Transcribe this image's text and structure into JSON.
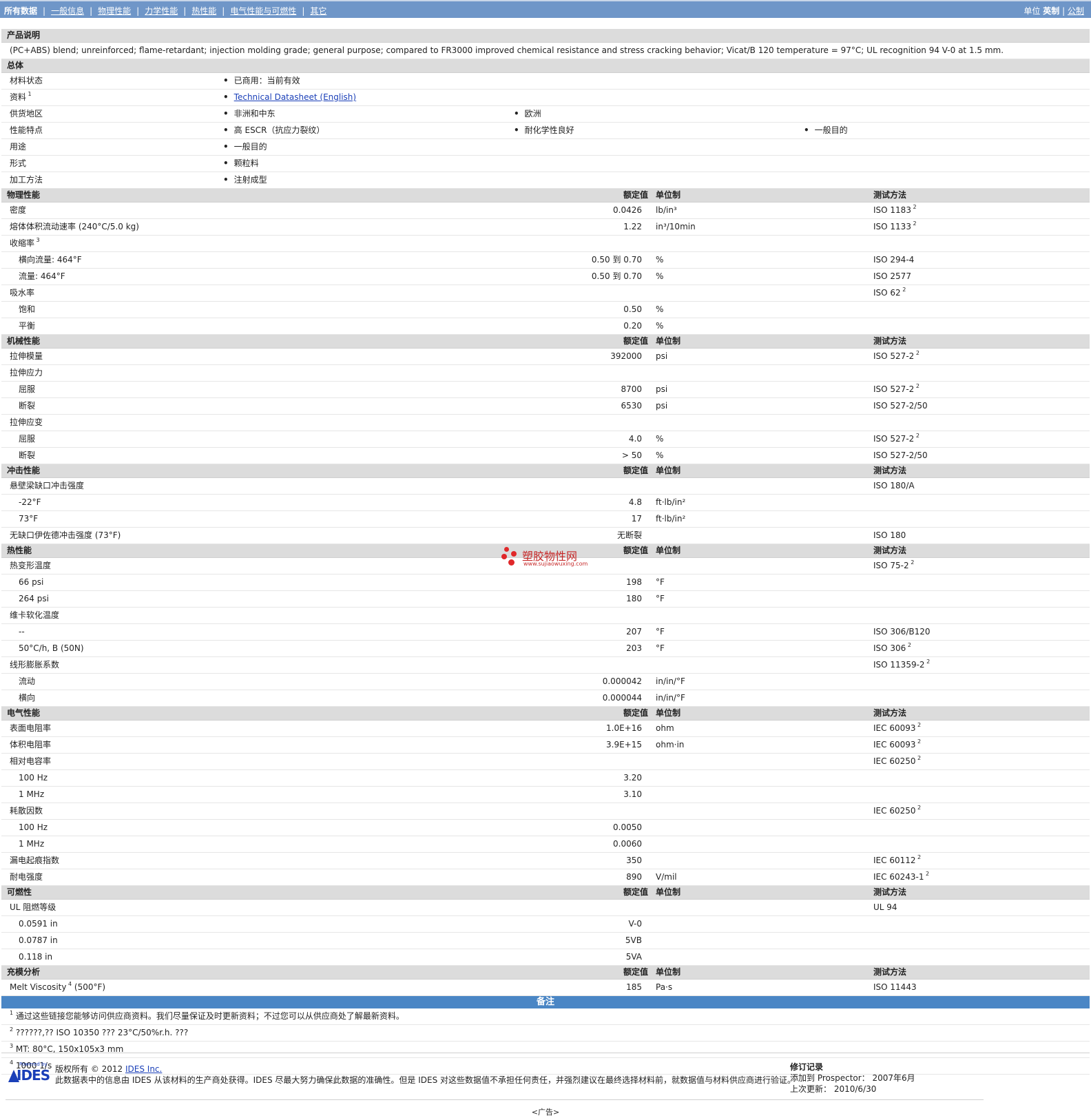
{
  "nav": {
    "tabs": [
      "所有数据",
      "一般信息",
      "物理性能",
      "力学性能",
      "热性能",
      "电气性能与可燃性",
      "其它"
    ],
    "units_label": "单位",
    "unit_active": "英制",
    "unit_sep": "|",
    "unit_other": "公制"
  },
  "product": {
    "header": "产品说明",
    "description": "(PC+ABS) blend; unreinforced; flame-retardant; injection molding grade; general purpose; compared to FR3000 improved chemical resistance and stress cracking behavior; Vicat/B 120 temperature = 97°C; UL recognition 94 V-0 at 1.5 mm."
  },
  "general": {
    "header": "总体",
    "rows": [
      {
        "label": "材料状态",
        "values": [
          "已商用：当前有效"
        ]
      },
      {
        "label": "资料",
        "sup": "1",
        "link": "Technical Datasheet (English)"
      },
      {
        "label": "供货地区",
        "values": [
          "非洲和中东",
          "欧洲"
        ]
      },
      {
        "label": "性能特点",
        "values": [
          "高 ESCR（抗应力裂纹）",
          "耐化学性良好",
          "一般目的"
        ]
      },
      {
        "label": "用途",
        "values": [
          "一般目的"
        ]
      },
      {
        "label": "形式",
        "values": [
          "颗粒料"
        ]
      },
      {
        "label": "加工方法",
        "values": [
          "注射成型"
        ]
      }
    ]
  },
  "col_headers": {
    "value": "额定值",
    "unit": "单位制",
    "method": "测试方法"
  },
  "sections": [
    {
      "title": "物理性能",
      "rows": [
        {
          "label": "密度",
          "value": "0.0426",
          "unit": "lb/in³",
          "method": "ISO 1183",
          "msup": "2"
        },
        {
          "label": "熔体体积流动速率 (240°C/5.0 kg)",
          "value": "1.22",
          "unit": "in³/10min",
          "method": "ISO 1133",
          "msup": "2"
        },
        {
          "label": "收缩率",
          "lsup": "3"
        },
        {
          "label": "横向流量: 464°F",
          "indent": true,
          "value": "0.50 到 0.70",
          "unit": "%",
          "method": "ISO 294-4"
        },
        {
          "label": "流量: 464°F",
          "indent": true,
          "value": "0.50 到 0.70",
          "unit": "%",
          "method": "ISO 2577"
        },
        {
          "label": "吸水率",
          "method": "ISO 62",
          "msup": "2"
        },
        {
          "label": "饱和",
          "indent": true,
          "value": "0.50",
          "unit": "%"
        },
        {
          "label": "平衡",
          "indent": true,
          "value": "0.20",
          "unit": "%"
        }
      ]
    },
    {
      "title": "机械性能",
      "rows": [
        {
          "label": "拉伸模量",
          "value": "392000",
          "unit": "psi",
          "method": "ISO 527-2",
          "msup": "2"
        },
        {
          "label": "拉伸应力"
        },
        {
          "label": "屈服",
          "indent": true,
          "value": "8700",
          "unit": "psi",
          "method": "ISO 527-2",
          "msup": "2"
        },
        {
          "label": "断裂",
          "indent": true,
          "value": "6530",
          "unit": "psi",
          "method": "ISO 527-2/50"
        },
        {
          "label": "拉伸应变"
        },
        {
          "label": "屈服",
          "indent": true,
          "value": "4.0",
          "unit": "%",
          "method": "ISO 527-2",
          "msup": "2"
        },
        {
          "label": "断裂",
          "indent": true,
          "value": "> 50",
          "unit": "%",
          "method": "ISO 527-2/50"
        }
      ]
    },
    {
      "title": "冲击性能",
      "rows": [
        {
          "label": "悬壁梁缺口冲击强度",
          "method": "ISO 180/A"
        },
        {
          "label": "-22°F",
          "indent": true,
          "value": "4.8",
          "unit": "ft·lb/in²"
        },
        {
          "label": "73°F",
          "indent": true,
          "value": "17",
          "unit": "ft·lb/in²"
        },
        {
          "label": "无缺口伊佐德冲击强度 (73°F)",
          "value": "无断裂",
          "method": "ISO 180"
        }
      ]
    },
    {
      "title": "热性能",
      "rows": [
        {
          "label": "热变形温度",
          "method": "ISO 75-2",
          "msup": "2"
        },
        {
          "label": "66 psi",
          "indent": true,
          "value": "198",
          "unit": "°F"
        },
        {
          "label": "264 psi",
          "indent": true,
          "value": "180",
          "unit": "°F"
        },
        {
          "label": "维卡软化温度"
        },
        {
          "label": "--",
          "indent": true,
          "value": "207",
          "unit": "°F",
          "method": "ISO 306/B120"
        },
        {
          "label": "50°C/h, B (50N)",
          "indent": true,
          "value": "203",
          "unit": "°F",
          "method": "ISO 306",
          "msup": "2"
        },
        {
          "label": "线形膨胀系数",
          "method": "ISO 11359-2",
          "msup": "2"
        },
        {
          "label": "流动",
          "indent": true,
          "value": "0.000042",
          "unit": "in/in/°F"
        },
        {
          "label": "横向",
          "indent": true,
          "value": "0.000044",
          "unit": "in/in/°F"
        }
      ]
    },
    {
      "title": "电气性能",
      "rows": [
        {
          "label": "表面电阻率",
          "value": "1.0E+16",
          "unit": "ohm",
          "method": "IEC 60093",
          "msup": "2"
        },
        {
          "label": "体积电阻率",
          "value": "3.9E+15",
          "unit": "ohm·in",
          "method": "IEC 60093",
          "msup": "2"
        },
        {
          "label": "相对电容率",
          "method": "IEC 60250",
          "msup": "2"
        },
        {
          "label": "100 Hz",
          "indent": true,
          "value": "3.20"
        },
        {
          "label": "1 MHz",
          "indent": true,
          "value": "3.10"
        },
        {
          "label": "耗散因数",
          "method": "IEC 60250",
          "msup": "2"
        },
        {
          "label": "100 Hz",
          "indent": true,
          "value": "0.0050"
        },
        {
          "label": "1 MHz",
          "indent": true,
          "value": "0.0060"
        },
        {
          "label": "漏电起痕指数",
          "value": "350",
          "method": "IEC 60112",
          "msup": "2"
        },
        {
          "label": "耐电强度",
          "value": "890",
          "unit": "V/mil",
          "method": "IEC 60243-1",
          "msup": "2"
        }
      ]
    },
    {
      "title": "可燃性",
      "rows": [
        {
          "label": "UL 阻燃等级",
          "method": "UL 94"
        },
        {
          "label": "0.0591 in",
          "indent": true,
          "value": "V-0"
        },
        {
          "label": "0.0787 in",
          "indent": true,
          "value": "5VB"
        },
        {
          "label": "0.118 in",
          "indent": true,
          "value": "5VA"
        }
      ]
    },
    {
      "title": "充模分析",
      "rows": [
        {
          "label": "Melt Viscosity",
          "lsup": "4",
          "label_suffix": " (500°F)",
          "value": "185",
          "unit": "Pa·s",
          "method": "ISO 11443"
        }
      ]
    }
  ],
  "notes": {
    "header": "备注",
    "items": [
      {
        "n": "1",
        "text": "通过这些链接您能够访问供应商资料。我们尽量保证及时更新资料；不过您可以从供应商处了解最新资料。"
      },
      {
        "n": "2",
        "text": "??????,?? ISO 10350 ??? 23°C/50%r.h. ???"
      },
      {
        "n": "3",
        "text": "MT: 80°C, 150x105x3 mm"
      },
      {
        "n": "4",
        "text": "1000 1/s"
      }
    ]
  },
  "watermark": {
    "title": "塑胶物性网",
    "url": "www.sujiaowuxing.com"
  },
  "footer": {
    "powered": "Powered by",
    "logo": "IDES",
    "copyright_pre": "版权所有 © 2012 ",
    "copyright_link": "IDES Inc.",
    "disclaimer": "此数据表中的信息由 IDES 从该材料的生产商处获得。IDES 尽最大努力确保此数据的准确性。但是 IDES 对这些数据值不承担任何责任，并强烈建议在最终选择材料前，就数据值与材料供应商进行验证。",
    "rev_title": "修订记录",
    "rev_added": "添加到 Prospector： 2007年6月",
    "rev_updated": "上次更新： 2010/6/30",
    "ad": "<广告>"
  }
}
